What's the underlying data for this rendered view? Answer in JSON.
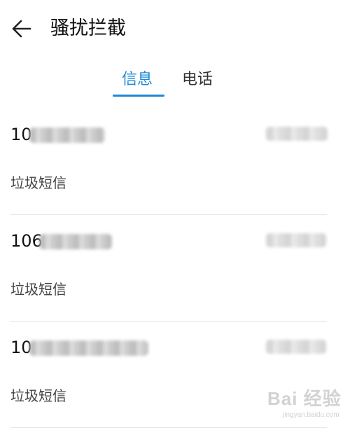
{
  "header": {
    "title": "骚扰拦截",
    "back_icon": "arrow-left-icon"
  },
  "tabs": [
    {
      "label": "信息",
      "selected": true
    },
    {
      "label": "电话",
      "selected": false
    }
  ],
  "accent_color": "#1e88d6",
  "messages": [
    {
      "sender_prefix": "10",
      "category": "垃圾短信"
    },
    {
      "sender_prefix": "106",
      "category": "垃圾短信"
    },
    {
      "sender_prefix": "10",
      "category": "垃圾短信"
    }
  ],
  "watermark": {
    "brand": "Bai  经验",
    "sub": "jingyan.baidu.com"
  }
}
